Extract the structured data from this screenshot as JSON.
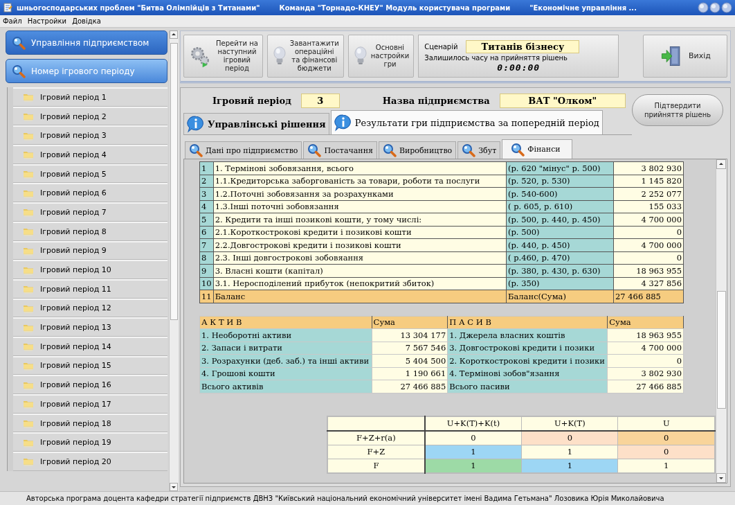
{
  "window": {
    "title_parts": [
      "шньогосподарських проблем \"Битва Олімпійців з Титанами\"",
      "Команда \"Торнадо-КНЕУ\" Модуль користувача програми",
      "\"Економічне управління ..."
    ]
  },
  "menu": [
    "Файл",
    "Настройки",
    "Довідка"
  ],
  "sidebar": {
    "headers": [
      {
        "label": "Управління підприємством",
        "selected": false
      },
      {
        "label": "Номер ігрового періоду",
        "selected": true
      }
    ],
    "items": [
      "Ігровий період 1",
      "Ігровий період 2",
      "Ігровий період 3",
      "Ігровий період 4",
      "Ігровий період 5",
      "Ігровий період 6",
      "Ігровий період 7",
      "Ігровий період 8",
      "Ігровий період 9",
      "Ігровий період 10",
      "Ігровий період 11",
      "Ігровий період 12",
      "Ігровий період 13",
      "Ігровий період 14",
      "Ігровий період 15",
      "Ігровий період 16",
      "Ігровий період 17",
      "Ігровий період 18",
      "Ігровий період 19",
      "Ігровий період 20"
    ]
  },
  "toolbar": {
    "buttons": [
      {
        "kind": "gear",
        "label": "Перейти на\nнаступний\nігровий\nперіод"
      },
      {
        "kind": "bulb",
        "label": "Завантажити\nопераційні\nта фінансові\nбюджети"
      },
      {
        "kind": "bulb",
        "label": "Основні\nнастройки\nгри"
      }
    ],
    "scenario": {
      "label": "Сценарій",
      "value": "Титанів бізнесу",
      "timer_label": "Залишилось часу на прийняття рішень",
      "timer": "0:00:00"
    },
    "exit": {
      "label": "Вихід"
    }
  },
  "content": {
    "period_label": "Ігровий період",
    "period": "3",
    "company_label": "Назва підприємства",
    "company": "ВАТ \"Олком\"",
    "confirm_button": "Підтвердити\nприйняття рішень",
    "tabs": [
      {
        "label": "Управлінські рішення",
        "selected": false
      },
      {
        "label": "Результати гри підприємства за попередній період",
        "selected": true
      }
    ],
    "subtabs": [
      {
        "label": "Дані про підприємство",
        "selected": false
      },
      {
        "label": "Постачання",
        "selected": false
      },
      {
        "label": "Виробництво",
        "selected": false
      },
      {
        "label": "Збут",
        "selected": false
      },
      {
        "label": "Фінанси",
        "selected": true
      }
    ],
    "liabilities_table": {
      "rows": [
        {
          "kind": "item",
          "num": "1",
          "name": "1. Термінові зобовязання, всього",
          "ref": "(р. 620 \"мінус\"  р. 500)",
          "value": "3 802 930"
        },
        {
          "kind": "item",
          "num": "2",
          "name": "1.1.Кредиторська заборгованість за товари, роботи та послуги",
          "ref": "(р. 520, р. 530)",
          "value": "1 145 820"
        },
        {
          "kind": "item",
          "num": "3",
          "name": "1.2.Поточні зобовязання за розрахунками",
          "ref": "(р. 540-600)",
          "value": "2 252 077"
        },
        {
          "kind": "item",
          "num": "4",
          "name": "1.3.Інші поточні зобовязання",
          "ref": "( р. 605, р. 610)",
          "value": "155 033"
        },
        {
          "kind": "item",
          "num": "5",
          "name": "2. Кредити та інші позикові кошти, у тому числі:",
          "ref": "(р. 500, р. 440, р. 450)",
          "value": "4 700 000"
        },
        {
          "kind": "item",
          "num": "6",
          "name": "2.1.Короткострокові кредити і позикові кошти",
          "ref": "(р. 500)",
          "value": "0"
        },
        {
          "kind": "item",
          "num": "7",
          "name": "2.2.Довгострокові кредити і позикові кошти",
          "ref": "(р. 440, р. 450)",
          "value": "4 700 000"
        },
        {
          "kind": "item",
          "num": "8",
          "name": "2.3. Інші довгострокові зобовяання",
          "ref": "( р.460, р. 470)",
          "value": "0"
        },
        {
          "kind": "item",
          "num": "9",
          "name": "3. Власні кошти (капітал)",
          "ref": "(р. 380, р. 430, р. 630)",
          "value": "18 963 955"
        },
        {
          "kind": "item",
          "num": "10",
          "name": "3.1. Неросподілений прибуток (непокритий збиток)",
          "ref": "(р. 350)",
          "value": "4 327 856"
        },
        {
          "kind": "total",
          "num": "11",
          "name": "Баланс",
          "ref": "Баланс(Сума)",
          "value": "27 466 885"
        }
      ]
    },
    "balance_table": {
      "columns": [
        "А К Т И В",
        "Сума",
        "П А С И В",
        "Сума"
      ],
      "rows": [
        [
          "1. Необоротні активи",
          "13 304 177",
          "1. Джерела власних коштів",
          "18 963 955"
        ],
        [
          "2. Запаси і витрати",
          "7 567 546",
          "3. Довгострокові кредити і позики",
          "4 700 000"
        ],
        [
          "3. Розрахунки (деб. заб.) та інші активи",
          "5 404 500",
          "2. Короткострокові кредити і позики",
          "0"
        ],
        [
          "4. Грошові кошти",
          "1 190 661",
          "4. Термінові зобов\"язання",
          "3 802 930"
        ],
        [
          "Всього активів",
          "27 466 885",
          "Всього пасиви",
          "27 466 885"
        ]
      ]
    },
    "matrix": {
      "columns": [
        "U+K(T)+K(t)",
        "U+K(T)",
        "U"
      ],
      "rows": [
        {
          "label": "F+Z+r(a)",
          "cells": [
            {
              "value": "0",
              "color": "#fffde4"
            },
            {
              "value": "0",
              "color": "#fde0c8"
            },
            {
              "value": "0",
              "color": "#f8d49a"
            }
          ]
        },
        {
          "label": "F+Z",
          "cells": [
            {
              "value": "1",
              "color": "#9dd6f4"
            },
            {
              "value": "1",
              "color": "#fffde4"
            },
            {
              "value": "0",
              "color": "#fde0c8"
            }
          ]
        },
        {
          "label": "F",
          "cells": [
            {
              "value": "1",
              "color": "#9ddaa6"
            },
            {
              "value": "1",
              "color": "#9dd6f4"
            },
            {
              "value": "1",
              "color": "#fffde4"
            }
          ]
        }
      ]
    }
  },
  "status_bar": "Авторська програма доцента кафедри стратегії підприємств ДВНЗ \"Київський національний економічний університет імені Вадима Гетьмана\" Лозовика Юрія Миколайовича"
}
